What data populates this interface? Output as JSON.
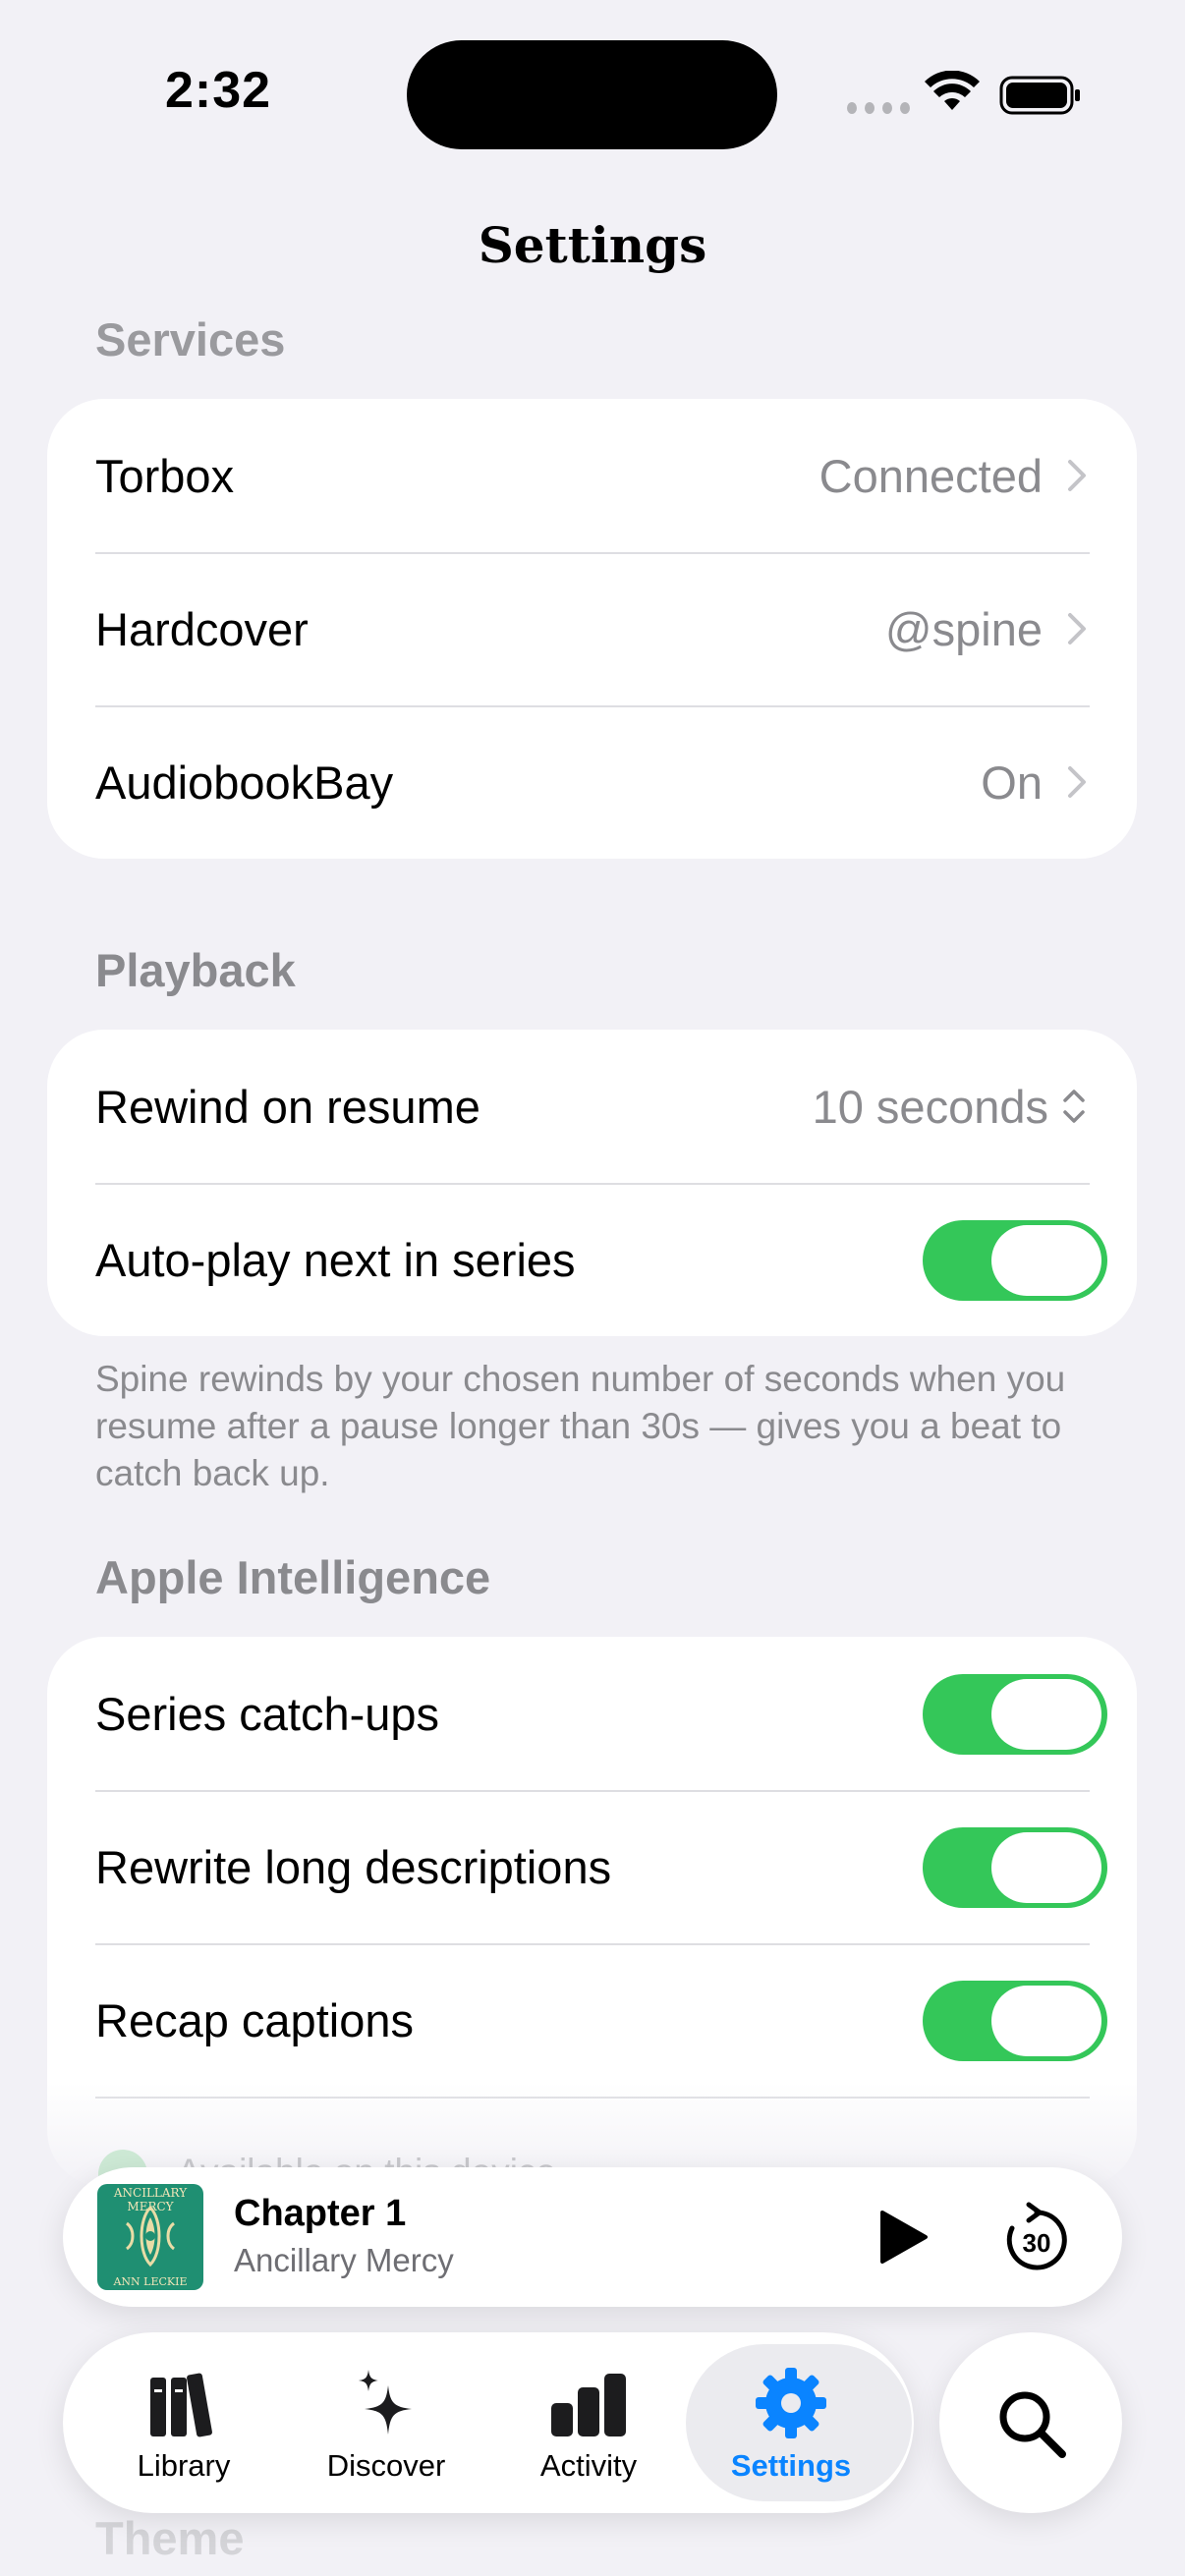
{
  "status_bar": {
    "time": "2:32"
  },
  "nav": {
    "title": "Settings"
  },
  "sections": {
    "services": {
      "header": "Services",
      "rows": [
        {
          "label": "Torbox",
          "value": "Connected"
        },
        {
          "label": "Hardcover",
          "value": "@spine"
        },
        {
          "label": "AudiobookBay",
          "value": "On"
        }
      ]
    },
    "playback": {
      "header": "Playback",
      "rewind": {
        "label": "Rewind on resume",
        "value": "10 seconds"
      },
      "autoplay": {
        "label": "Auto-play next in series",
        "on": true
      },
      "footnote": "Spine rewinds by your chosen number of seconds when you resume after a pause longer than 30s — gives you a beat to catch back up."
    },
    "apple_intelligence": {
      "header": "Apple Intelligence",
      "rows": [
        {
          "label": "Series catch-ups",
          "on": true
        },
        {
          "label": "Rewrite long descriptions",
          "on": true
        },
        {
          "label": "Recap captions",
          "on": true
        }
      ],
      "status_text": "Available on this device"
    },
    "theme": {
      "header": "Theme"
    }
  },
  "mini_player": {
    "title": "Chapter 1",
    "subtitle": "Ancillary Mercy",
    "cover_title": "ANCILLARY MERCY",
    "cover_author": "ANN LECKIE",
    "skip_seconds": "30"
  },
  "tab_bar": {
    "tabs": [
      {
        "label": "Library",
        "icon": "books-icon"
      },
      {
        "label": "Discover",
        "icon": "sparkles-icon"
      },
      {
        "label": "Activity",
        "icon": "bar-chart-icon"
      },
      {
        "label": "Settings",
        "icon": "gear-icon",
        "active": true
      }
    ],
    "search_icon": "search-icon"
  },
  "colors": {
    "background": "#f2f1f6",
    "toggle_on": "#34c759",
    "accent": "#0a84ff",
    "secondary_text": "#8a8a8e"
  }
}
